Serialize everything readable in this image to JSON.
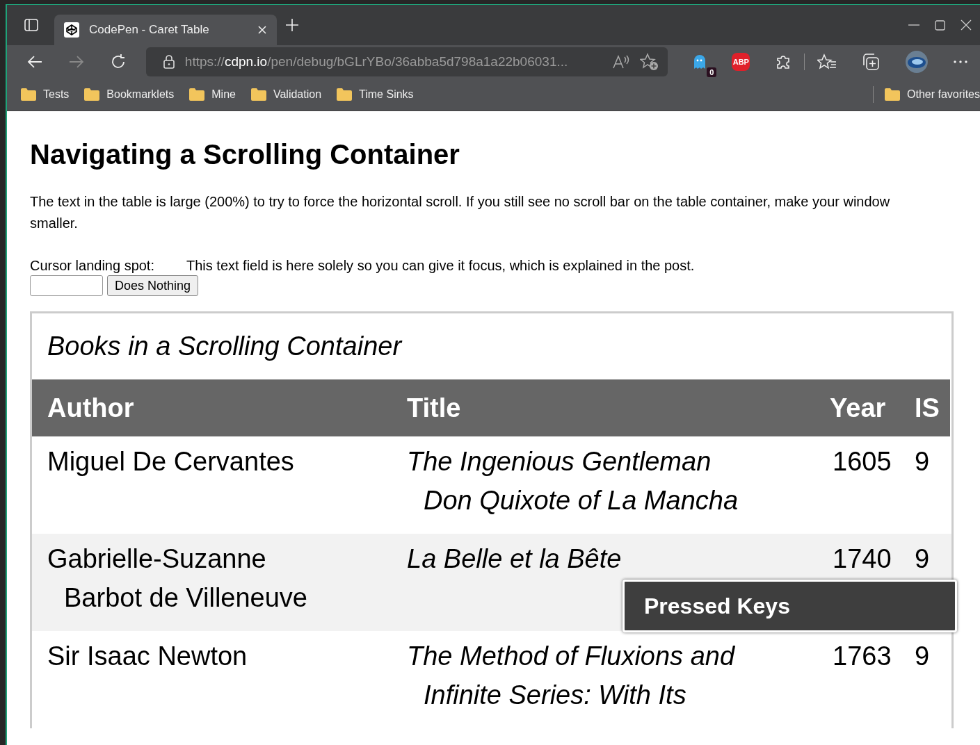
{
  "browser": {
    "tabs": [
      {
        "title": "CodePen - Caret Table",
        "selected": true
      }
    ],
    "address": {
      "scheme": "https://",
      "host": "cdpn.io",
      "path": "/pen/debug/bGLrYBo/36abba5d798a1a22b06031..."
    },
    "extension_badge": "0",
    "adblock_label": "ABP",
    "bookmarks": [
      {
        "label": "Tests"
      },
      {
        "label": "Bookmarklets"
      },
      {
        "label": "Mine"
      },
      {
        "label": "Validation"
      },
      {
        "label": "Time Sinks"
      }
    ],
    "other_bookmarks": "Other favorites"
  },
  "page": {
    "heading": "Navigating a Scrolling Container",
    "intro": "The text in the table is large (200%) to try to force the horizontal scroll. If you still see no scroll bar on the table container, make your window smaller.",
    "field_label": "Cursor landing spot:",
    "field_note": "This text field is here solely so you can give it focus, which is explained in the post.",
    "button": "Does Nothing",
    "table": {
      "caption": "Books in a Scrolling Container",
      "columns": [
        "Author",
        "Title",
        "Year",
        "IS"
      ],
      "rows": [
        {
          "author": [
            "Miguel De Cervantes"
          ],
          "title": [
            "The Ingenious Gentleman",
            "Don Quixote of La Mancha"
          ],
          "year": "1605",
          "isbn": "9"
        },
        {
          "author": [
            "Gabrielle-Suzanne",
            "Barbot de Villeneuve"
          ],
          "title": [
            "La Belle et la Bête"
          ],
          "year": "1740",
          "isbn": "9"
        },
        {
          "author": [
            "Sir Isaac Newton"
          ],
          "title": [
            "The Method of Fluxions and",
            "Infinite Series: With Its"
          ],
          "year": "1763",
          "isbn": "9"
        }
      ]
    }
  },
  "overlay": {
    "title": "Pressed Keys"
  }
}
